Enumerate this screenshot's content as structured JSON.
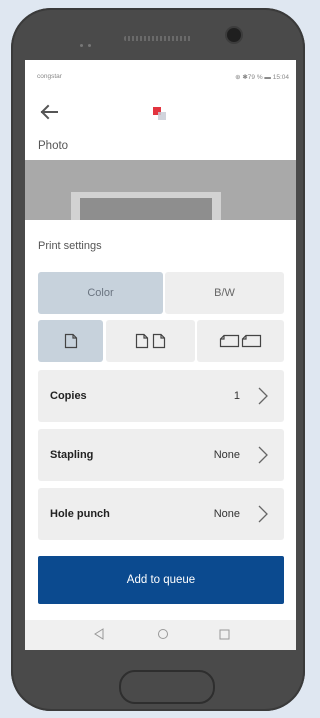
{
  "status": {
    "carrier": "congstar",
    "right": "⊕ ✱79 % ▬ 15:04"
  },
  "header": {
    "title": "Photo"
  },
  "print_settings": {
    "label": "Print settings",
    "color_mode": {
      "options": [
        "Color",
        "B/W"
      ],
      "selected": "Color"
    },
    "layout_options": [
      "single-page-icon",
      "two-pages-icon",
      "two-pages-landscape-icon"
    ],
    "rows": [
      {
        "label": "Copies",
        "value": "1"
      },
      {
        "label": "Stapling",
        "value": "None"
      },
      {
        "label": "Hole punch",
        "value": "None"
      }
    ]
  },
  "actions": {
    "add_to_queue": "Add to queue"
  },
  "colors": {
    "primary": "#0b4a8f",
    "selected_segment": "#c7d2dc",
    "brand_red": "#e2343f"
  }
}
